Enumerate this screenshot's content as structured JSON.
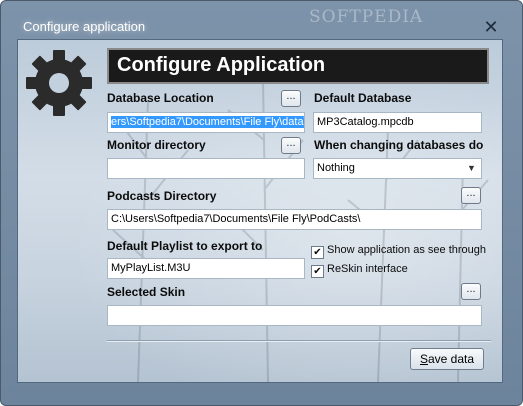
{
  "window": {
    "title": "Configure application",
    "watermark": "SOFTPEDIA",
    "close_symbol": "✕"
  },
  "header": {
    "title": "Configure Application"
  },
  "database_location": {
    "label": "Database Location",
    "value": "ers\\Softpedia7\\Documents\\File Fly\\data\\",
    "browse_label": "..."
  },
  "default_database": {
    "label": "Default Database",
    "value": "MP3Catalog.mpcdb"
  },
  "monitor_directory": {
    "label": "Monitor directory",
    "value": "",
    "browse_label": "..."
  },
  "when_changing": {
    "label": "When changing databases do",
    "selected": "Nothing",
    "arrow": "▼"
  },
  "podcasts_directory": {
    "label": "Podcasts Directory",
    "value": "C:\\Users\\Softpedia7\\Documents\\File Fly\\PodCasts\\",
    "browse_label": "..."
  },
  "default_playlist": {
    "label": "Default Playlist to export to",
    "value": "MyPlayList.M3U"
  },
  "options": {
    "see_through": {
      "label": "Show application as see through",
      "checked": true,
      "mark": "✔"
    },
    "reskin": {
      "label": "ReSkin interface",
      "checked": true,
      "mark": "✔"
    }
  },
  "selected_skin": {
    "label": "Selected Skin",
    "value": "",
    "browse_label": "..."
  },
  "save": {
    "prefix": "S",
    "rest": "ave data"
  }
}
